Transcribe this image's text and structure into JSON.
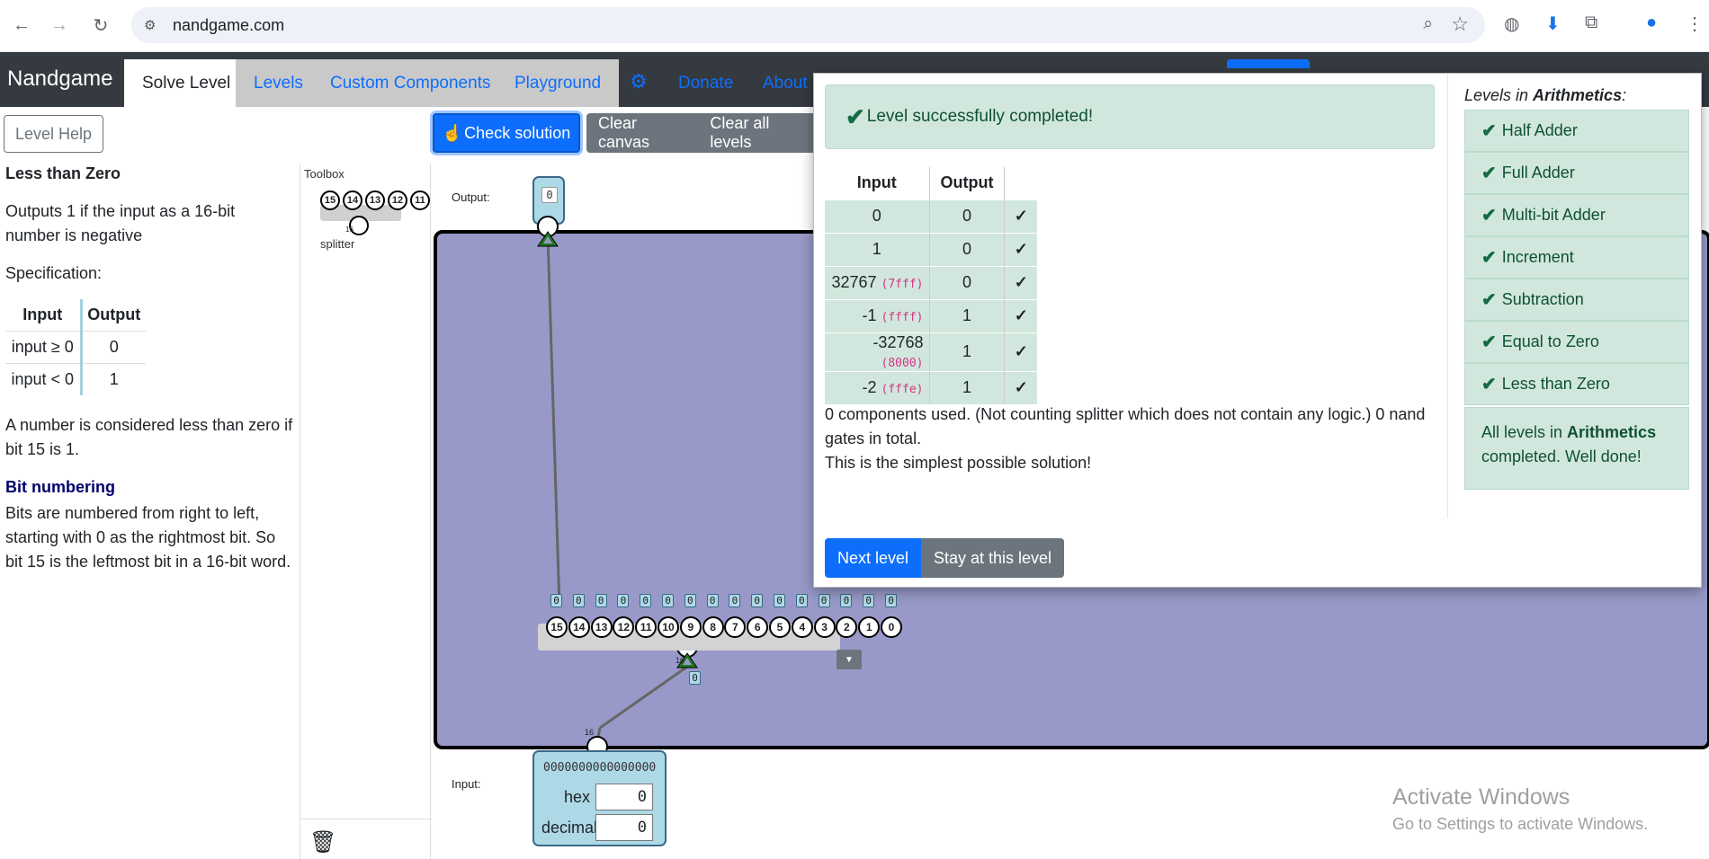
{
  "browser": {
    "url": "nandgame.com"
  },
  "navbar": {
    "brand": "Nandgame",
    "tabs": [
      {
        "label": "Solve Level"
      },
      {
        "label": "Levels"
      },
      {
        "label": "Custom Components"
      },
      {
        "label": "Playground"
      }
    ],
    "links": [
      {
        "label": "Donate"
      },
      {
        "label": "About"
      }
    ]
  },
  "help": {
    "button": "Level Help",
    "title": "Less than Zero",
    "intro": "Outputs 1 if the input as a 16-bit number is negative",
    "spec_label": "Specification:",
    "spec_headers": [
      "Input",
      "Output"
    ],
    "spec_rows": [
      [
        "input ≥ 0",
        "0"
      ],
      [
        "input < 0",
        "1"
      ]
    ],
    "note": "A number is considered less than zero if bit 15 is 1.",
    "bit_heading": "Bit numbering",
    "bit_text": "Bits are numbered from right to left, starting with 0 as the rightmost bit. So bit 15 is the leftmost bit in a 16-bit word."
  },
  "toolbox": {
    "title": "Toolbox",
    "component_label": "splitter",
    "mini_bits": [
      "15",
      "14",
      "13",
      "12",
      "11"
    ],
    "mini_width": "16"
  },
  "toolbar": {
    "check": "Check solution",
    "clear_canvas": "Clear canvas",
    "clear_all": "Clear all levels"
  },
  "canvas": {
    "output_label": "Output:",
    "output_value": "0",
    "input_label": "Input:",
    "input_bits": "0000000000000000",
    "hex_label": "hex",
    "hex_value": "0",
    "decimal_label": "decimal",
    "decimal_value": "0",
    "splitter_bits": [
      "15",
      "14",
      "13",
      "12",
      "11",
      "10",
      "9",
      "8",
      "7",
      "6",
      "5",
      "4",
      "3",
      "2",
      "1",
      "0"
    ],
    "splitter_values": [
      "0",
      "0",
      "0",
      "0",
      "0",
      "0",
      "0",
      "0",
      "0",
      "0",
      "0",
      "0",
      "0",
      "0",
      "0",
      "0"
    ],
    "splitter_in_value": "0",
    "wire_width": "16",
    "splitter_width": "16"
  },
  "watermark": {
    "line1": "Activate Windows",
    "line2": "Go to Settings to activate Windows."
  },
  "result": {
    "success": "Level successfully completed!",
    "headers": [
      "Input",
      "Output"
    ],
    "rows": [
      {
        "input": "0",
        "hex": "",
        "output": "0",
        "check": "✓"
      },
      {
        "input": "1",
        "hex": "",
        "output": "0",
        "check": "✓"
      },
      {
        "input": "32767",
        "hex": "(7fff)",
        "output": "0",
        "check": "✓"
      },
      {
        "input": "-1",
        "hex": "(ffff)",
        "output": "1",
        "check": "✓"
      },
      {
        "input": "-32768",
        "hex": "(8000)",
        "output": "1",
        "check": "✓"
      },
      {
        "input": "-2",
        "hex": "(fffe)",
        "output": "1",
        "check": "✓"
      }
    ],
    "components_text": "0 components used. (Not counting splitter which does not contain any logic.) 0 nand gates in total.",
    "simplest_text": "This is the simplest possible solution!",
    "next_button": "Next level",
    "stay_button": "Stay at this level",
    "levels_prefix": "Levels in ",
    "levels_group": "Arithmetics",
    "levels_suffix": ":",
    "levels": [
      {
        "label": "Half Adder"
      },
      {
        "label": "Full Adder"
      },
      {
        "label": "Multi-bit Adder"
      },
      {
        "label": "Increment"
      },
      {
        "label": "Subtraction"
      },
      {
        "label": "Equal to Zero"
      },
      {
        "label": "Less than Zero"
      }
    ],
    "done_prefix": "All levels in ",
    "done_group": "Arithmetics",
    "done_suffix": " completed. Well done!"
  }
}
